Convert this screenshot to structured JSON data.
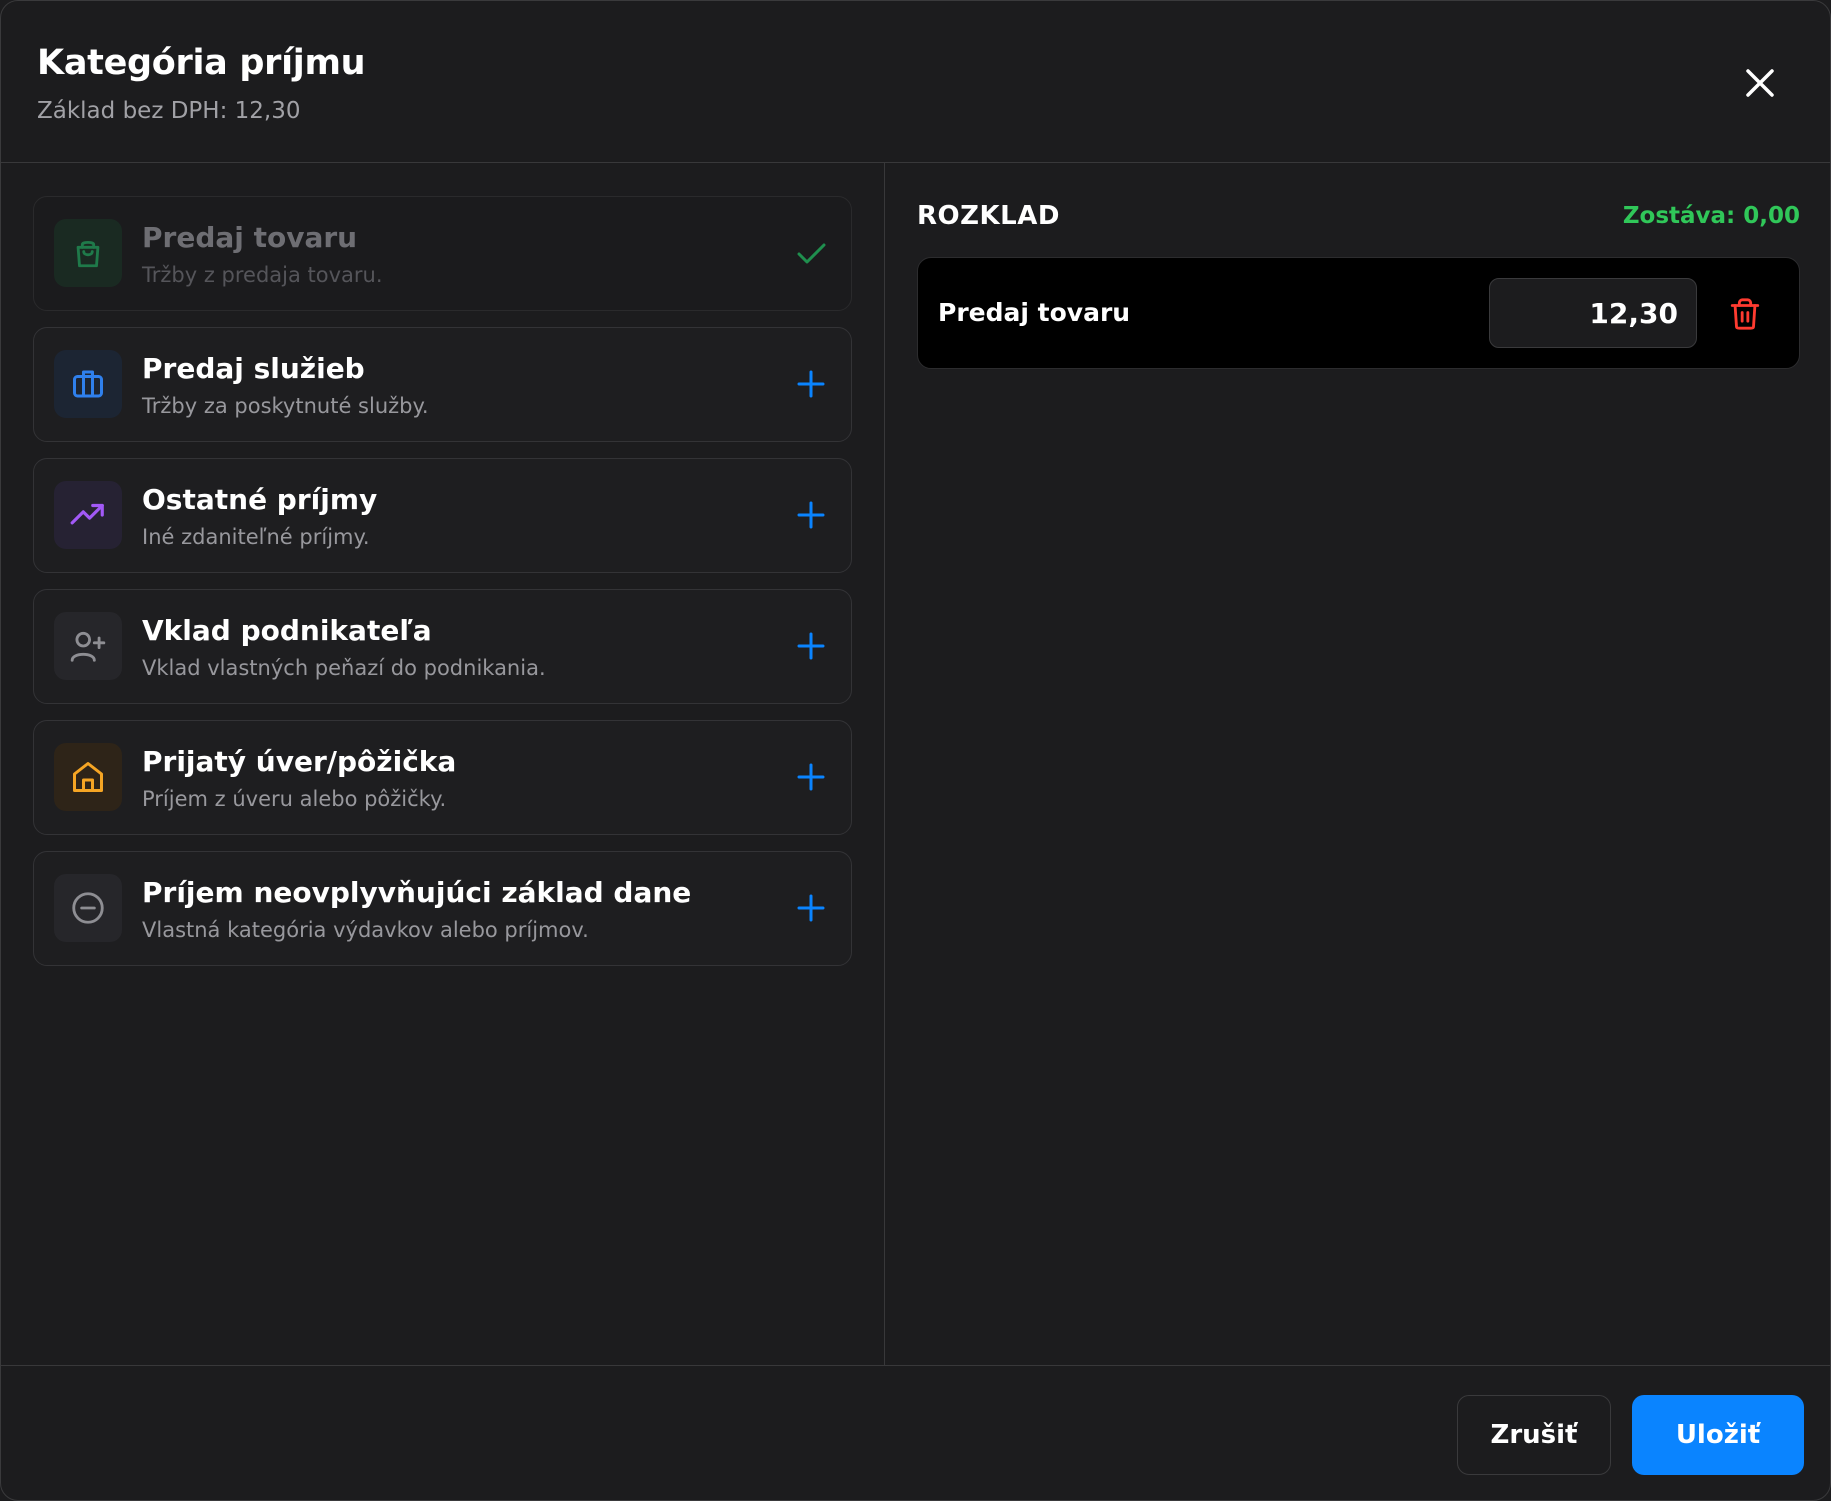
{
  "header": {
    "title": "Kategória príjmu",
    "subtitle": "Základ bez DPH: 12,30"
  },
  "categories": [
    {
      "title": "Predaj tovaru",
      "description": "Tržby z predaja tovaru.",
      "icon": "shopping-bag-icon",
      "state": "selected",
      "accent": "#30d158"
    },
    {
      "title": "Predaj služieb",
      "description": "Tržby za poskytnuté služby.",
      "icon": "briefcase-icon",
      "state": "add",
      "accent": "#0a84ff"
    },
    {
      "title": "Ostatné príjmy",
      "description": "Iné zdaniteľné príjmy.",
      "icon": "trending-up-icon",
      "state": "add",
      "accent": "#bf5af2"
    },
    {
      "title": "Vklad podnikateľa",
      "description": "Vklad vlastných peňazí do podnikania.",
      "icon": "user-plus-icon",
      "state": "add",
      "accent": "#98989d"
    },
    {
      "title": "Prijatý úver/pôžička",
      "description": "Príjem z úveru alebo pôžičky.",
      "icon": "home-icon",
      "state": "add",
      "accent": "#ff9f0a"
    },
    {
      "title": "Príjem neovplyvňujúci základ dane",
      "description": "Vlastná kategória výdavkov alebo príjmov.",
      "icon": "minus-circle-icon",
      "state": "add",
      "accent": "#98989d"
    }
  ],
  "breakdown": {
    "title": "ROZKLAD",
    "remaining": "Zostáva: 0,00",
    "remaining_color": "#30c759",
    "items": [
      {
        "name": "Predaj tovaru",
        "amount": "12,30"
      }
    ]
  },
  "footer": {
    "cancel_label": "Zrušiť",
    "save_label": "Uložiť"
  },
  "colors": {
    "background": "#1c1c1e",
    "primary": "#0a84ff",
    "danger": "#ff453a",
    "success": "#30c759"
  }
}
